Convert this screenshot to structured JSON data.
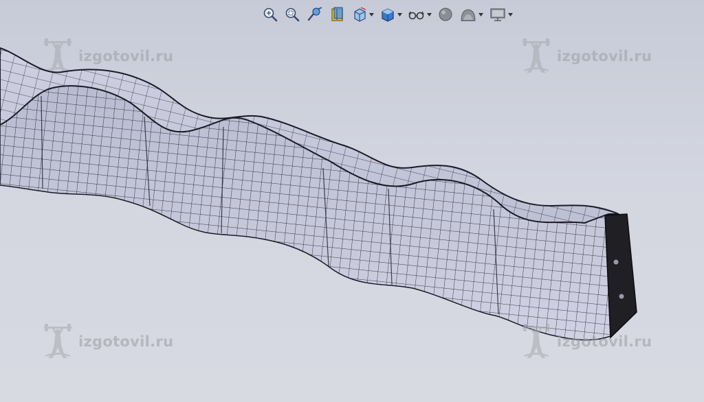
{
  "toolbar": {
    "buttons": [
      {
        "icon": "zoom-to-fit-icon",
        "dropdown": false
      },
      {
        "icon": "zoom-to-area-icon",
        "dropdown": false
      },
      {
        "icon": "previous-view-icon",
        "dropdown": false
      },
      {
        "icon": "section-view-icon",
        "dropdown": false
      },
      {
        "icon": "view-orientation-icon",
        "dropdown": true
      },
      {
        "icon": "display-style-icon",
        "dropdown": true
      },
      {
        "icon": "hide-show-items-icon",
        "dropdown": true
      },
      {
        "icon": "edit-appearance-icon",
        "dropdown": false
      },
      {
        "icon": "apply-scene-icon",
        "dropdown": true
      },
      {
        "icon": "view-settings-icon",
        "dropdown": true
      }
    ]
  },
  "watermarks": [
    {
      "text": "izgotovil.ru"
    },
    {
      "text": "izgotovil.ru"
    },
    {
      "text": "izgotovil.ru"
    },
    {
      "text": "izgotovil.ru"
    }
  ],
  "colors": {
    "background": "#cfd2dc",
    "model_face": "#c4c6d8",
    "model_lines": "#1c1c2a",
    "end_plate": "#202024",
    "watermark": "#9a9ca4"
  }
}
